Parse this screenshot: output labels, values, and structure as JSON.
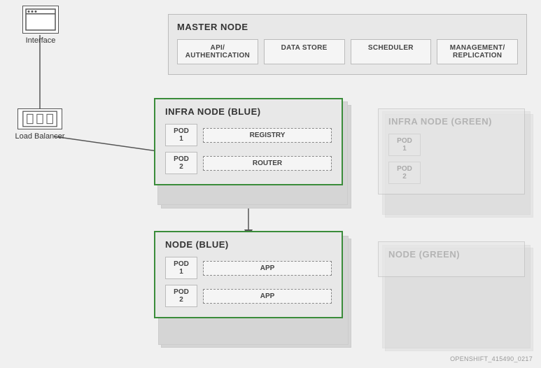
{
  "interface": {
    "label": "Interface"
  },
  "load_balancer": {
    "label": "Load Balancer"
  },
  "master_node": {
    "title": "MASTER NODE",
    "services": [
      {
        "id": "api-auth",
        "label": "API/\nAUTHENTICATION"
      },
      {
        "id": "data-store",
        "label": "DATA STORE"
      },
      {
        "id": "scheduler",
        "label": "SCHEDULER"
      },
      {
        "id": "mgmt-replication",
        "label": "MANAGEMENT/\nREPLICATION"
      }
    ]
  },
  "infra_node_blue": {
    "title": "INFRA NODE (BLUE)",
    "pods": [
      {
        "pod_label": "POD 1",
        "service_label": "REGISTRY"
      },
      {
        "pod_label": "POD 2",
        "service_label": "ROUTER"
      }
    ]
  },
  "infra_node_green": {
    "title": "INFRA NODE (GREEN)",
    "pods": [
      {
        "pod_label": "POD 1"
      },
      {
        "pod_label": "POD 2"
      }
    ]
  },
  "node_blue": {
    "title": "NODE (BLUE)",
    "pods": [
      {
        "pod_label": "POD 1",
        "service_label": "APP"
      },
      {
        "pod_label": "POD 2",
        "service_label": "APP"
      }
    ]
  },
  "node_green": {
    "title": "NODE (GREEN)",
    "pods": []
  },
  "watermark": {
    "text": "OPENSHIFT_415490_0217"
  }
}
